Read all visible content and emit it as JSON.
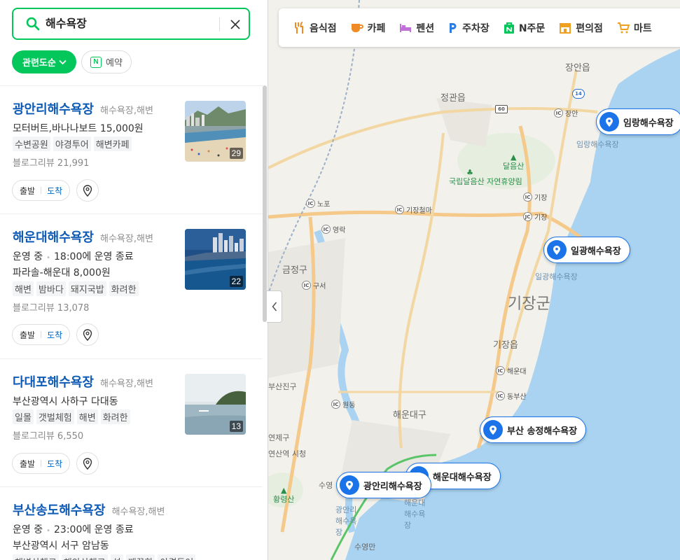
{
  "search": {
    "query": "해수욕장"
  },
  "filters": {
    "sort_label": "관련도순",
    "reserve_label": "예약",
    "reserve_badge": "N"
  },
  "results": [
    {
      "name": "광안리해수욕장",
      "category": "해수욕장,해변",
      "lines": [
        "모터버트,바나나보트 15,000원"
      ],
      "tags": [
        "수변공원",
        "야경투어",
        "해변카페"
      ],
      "review": "블로그리뷰 21,991",
      "photo_count": "29"
    },
    {
      "name": "해운대해수욕장",
      "category": "해수욕장,해변",
      "status": "운영 중",
      "hours": "18:00에 운영 종료",
      "lines": [
        "파라솔-해운대 8,000원"
      ],
      "tags": [
        "해변",
        "밤바다",
        "돼지국밥",
        "화려한"
      ],
      "review": "블로그리뷰 13,078",
      "photo_count": "22"
    },
    {
      "name": "다대포해수욕장",
      "category": "해수욕장,해변",
      "lines": [
        "부산광역시 사하구 다대동"
      ],
      "tags": [
        "일몰",
        "갯벌체험",
        "해변",
        "화려한"
      ],
      "review": "블로그리뷰 6,550",
      "photo_count": "13"
    },
    {
      "name": "부산송도해수욕장",
      "category": "해수욕장,해변",
      "status": "운영 중",
      "hours": "23:00에 운영 종료",
      "lines": [
        "부산광역시 서구 암남동"
      ],
      "tags": [
        "해변산책로",
        "해안산책로",
        "섬",
        "깨끗한",
        "야경투어"
      ]
    }
  ],
  "route": {
    "start": "출발",
    "end": "도착"
  },
  "categories": [
    {
      "label": "음식점",
      "icon": "fork-knife-icon",
      "color": "#f08a24"
    },
    {
      "label": "카페",
      "icon": "coffee-cup-icon",
      "color": "#f08a24"
    },
    {
      "label": "펜션",
      "icon": "bed-icon",
      "color": "#c070d8"
    },
    {
      "label": "주차장",
      "icon": "parking-icon",
      "color": "#2d7be5"
    },
    {
      "label": "N주문",
      "icon": "order-icon",
      "color": "#03c75a"
    },
    {
      "label": "편의점",
      "icon": "store-icon",
      "color": "#f0a020"
    },
    {
      "label": "마트",
      "icon": "cart-icon",
      "color": "#f0a020"
    }
  ],
  "map_labels": {
    "district": "기장군",
    "jangan": "장안읍",
    "jeonggwan": "정관읍",
    "gijang": "기장읍",
    "geumjeong": "금정구",
    "haeundae_gu": "해운대구",
    "yeonje": "연제구",
    "busanjin": "부산진구",
    "suyeong": "수영",
    "daldeum": "달음산",
    "forest": "국립달음산 자연휴양림",
    "hwangnyeong": "황령산",
    "suyeongman": "수영만",
    "ic_jangan": "장안",
    "ic_gijang": "기장",
    "ic_nopo": "노포",
    "ic_gijangcheolma": "기장철마",
    "ic_yeongrak": "영락",
    "ic_guseo": "구서",
    "ic_wondong": "원동",
    "ic_haeundae": "해운대",
    "ic_dongbusan": "동부산",
    "jc_gijang": "기장",
    "hw_14": "14",
    "hw_60": "60",
    "imrang_small": "임랑해수욕장",
    "ilgwang_small": "일광해수욕장",
    "haeundae_small": "해운대 해수욕장",
    "gwangalli_small": "광안리 해수욕장",
    "ic_tag": "IC",
    "jc_tag": "JC",
    "cityhall": "연산역 시청"
  },
  "markers": [
    "임랑해수욕장",
    "일광해수욕장",
    "부산 송정해수욕장",
    "해운대해수욕장",
    "광안리해수욕장"
  ]
}
